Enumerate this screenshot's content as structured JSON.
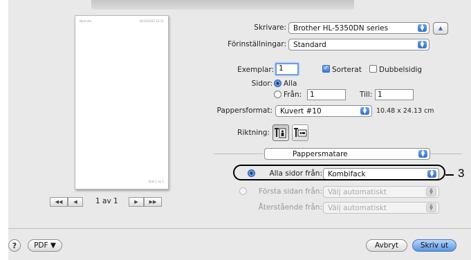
{
  "preview": {
    "header_left": "Namnlös",
    "header_right": "10/10/2012 12:11",
    "footer": "Sida 1 av 1",
    "page_indicator": "1 av 1"
  },
  "printer": {
    "label": "Skrivare:",
    "value": "Brother HL-5350DN series"
  },
  "presets": {
    "label": "Förinställningar:",
    "value": "Standard"
  },
  "copies": {
    "label": "Exemplar:",
    "value": "1",
    "collated_label": "Sorterat",
    "duplex_label": "Dubbelsidig"
  },
  "pages": {
    "label": "Sidor:",
    "all_label": "Alla",
    "from_label": "Från:",
    "from_value": "1",
    "to_label": "Till:",
    "to_value": "1"
  },
  "paper": {
    "label": "Pappersformat:",
    "value": "Kuvert #10",
    "size_text": "10.48 x 24.13 cm"
  },
  "orientation": {
    "label": "Riktning:"
  },
  "panel": {
    "value": "Pappersmatare"
  },
  "feed": {
    "all_pages_label": "Alla sidor från:",
    "all_pages_value": "Kombifack",
    "first_page_label": "Första sidan från:",
    "first_page_value": "Välj automatiskt",
    "remaining_label": "Återstående från:",
    "remaining_value": "Välj automatiskt"
  },
  "footer": {
    "help": "?",
    "pdf_label": "PDF ▼",
    "cancel_label": "Avbryt",
    "print_label": "Skriv ut"
  },
  "nav": {
    "first": "◀◀",
    "prev": "◀",
    "next": "▶",
    "last": "▶▶"
  },
  "callout": {
    "number": "3"
  },
  "colors": {
    "accent": "#3f7ad6",
    "background": "#e9e9e9"
  }
}
